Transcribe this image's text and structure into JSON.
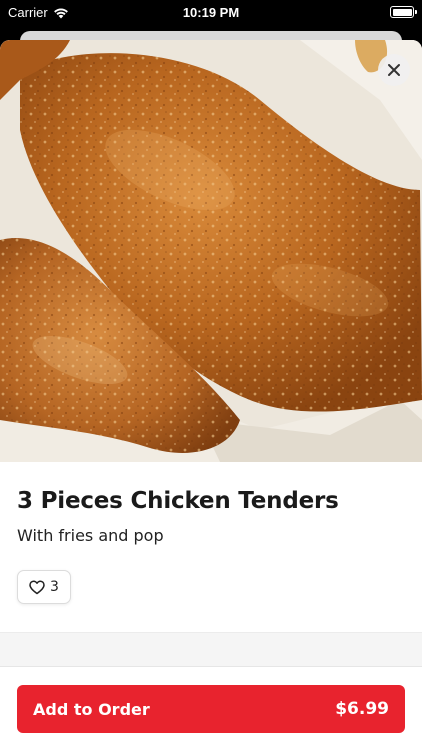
{
  "status_bar": {
    "carrier": "Carrier",
    "time": "10:19 PM",
    "icons": [
      "wifi-icon",
      "battery-icon"
    ]
  },
  "item": {
    "image_icon": "fried-chicken-tenders-photo",
    "title": "3 Pieces Chicken Tenders",
    "description": "With fries and pop",
    "likes": "3"
  },
  "close": {
    "icon": "close-icon"
  },
  "order": {
    "label": "Add to Order",
    "price": "$6.99"
  },
  "colors": {
    "accent": "#e8232e",
    "text": "#1a1a1a",
    "band": "#f5f5f5"
  }
}
